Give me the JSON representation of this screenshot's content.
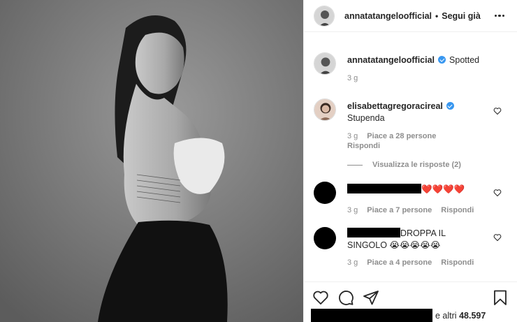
{
  "post": {
    "author": "annatatangeloofficial",
    "follow_label": "Segui già",
    "separator": "•"
  },
  "caption": {
    "username": "annatatangeloofficial",
    "text": "Spotted",
    "time": "3 g"
  },
  "comments": [
    {
      "username": "elisabettagregoracireal",
      "text": "Stupenda",
      "time": "3 g",
      "likes": "Piace a 28 persone",
      "reply": "Rispondi",
      "view_replies": "Visualizza le risposte (2)"
    },
    {
      "username": "",
      "text": "❤️❤️❤️❤️",
      "time": "3 g",
      "likes": "Piace a 7 persone",
      "reply": "Rispondi"
    },
    {
      "username": "",
      "text_line1": "DROPPA IL",
      "text_line2": "SINGOLO 😭😭😭😭😭",
      "time": "3 g",
      "likes": "Piace a 4 persone",
      "reply": "Rispondi"
    }
  ],
  "likes_summary": {
    "suffix": "e altri",
    "count": "48.597"
  },
  "icons": {
    "like": "heart-icon",
    "comment": "comment-icon",
    "share": "share-icon",
    "save": "bookmark-icon",
    "options": "more-options-icon",
    "verified": "verified-badge-icon"
  },
  "colors": {
    "text": "#262626",
    "muted": "#8e8e8e",
    "verified": "#3897f0",
    "border": "#efefef"
  }
}
